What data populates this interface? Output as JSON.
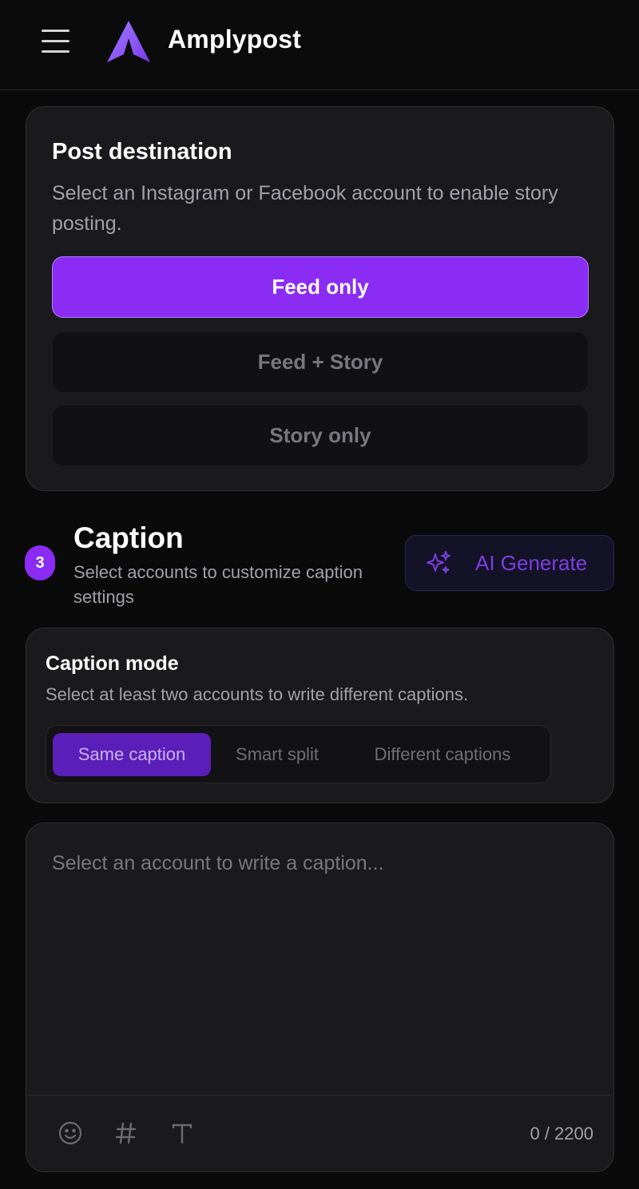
{
  "header": {
    "brand": "Amplypost",
    "brand_color": "#8b5cf6",
    "menu_icon": "hamburger-menu-icon",
    "logo_icon": "amplypost-logo-icon"
  },
  "post_destination": {
    "title": "Post destination",
    "subtitle": "Select an Instagram or Facebook account to enable story posting.",
    "options": [
      {
        "label": "Feed only",
        "selected": true
      },
      {
        "label": "Feed + Story",
        "selected": false
      },
      {
        "label": "Story only",
        "selected": false
      }
    ]
  },
  "caption": {
    "step": "3",
    "title": "Caption",
    "subtitle": "Select accounts to customize caption settings",
    "ai_button": {
      "label": "AI Generate",
      "icon": "sparkles-icon"
    }
  },
  "caption_mode": {
    "title": "Caption mode",
    "subtitle": "Select at least two accounts to write different captions.",
    "options": [
      {
        "label": "Same caption",
        "selected": true
      },
      {
        "label": "Smart split",
        "selected": false
      },
      {
        "label": "Different captions",
        "selected": false
      }
    ]
  },
  "editor": {
    "placeholder": "Select an account to write a caption...",
    "counter": "0 / 2200",
    "tools": [
      "emoji-icon",
      "hashtag-icon",
      "text-format-icon"
    ]
  },
  "colors": {
    "accent": "#8b2cf5",
    "background": "#0a0a0b",
    "card": "#1a1a1c"
  }
}
